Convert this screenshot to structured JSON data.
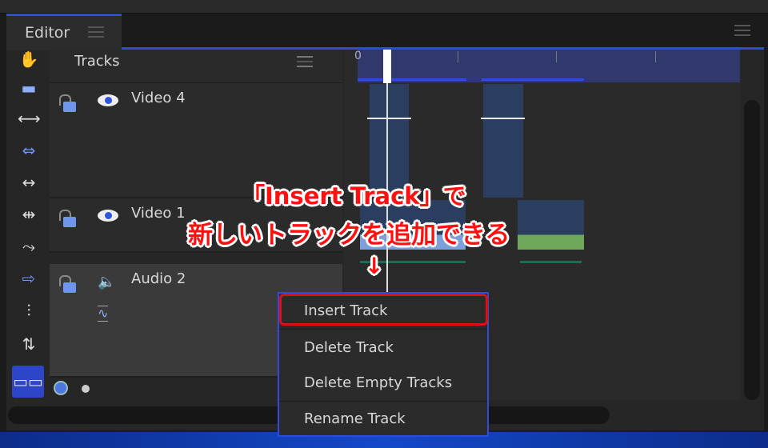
{
  "tab": {
    "title": "Editor"
  },
  "tracks": {
    "header": "Tracks",
    "rows": [
      {
        "name": "Video 4"
      },
      {
        "name": "Video 1"
      },
      {
        "name": "Audio 2"
      }
    ]
  },
  "ruler": {
    "start_label": "0"
  },
  "context_menu": {
    "items": [
      "Insert Track",
      "Delete Track",
      "Delete Empty Tracks",
      "Rename Track"
    ],
    "highlighted": "Insert Track"
  },
  "annotation": {
    "line1": "「Insert Track」で",
    "line2": "新しいトラックを追加できる",
    "arrow": "↓"
  },
  "colors": {
    "accent": "#2d4be0",
    "highlight": "#e01010",
    "annotation": "#ff1010"
  },
  "toolbar_icons": [
    "hand-icon",
    "ripple-icon",
    "fit-width-icon",
    "split-icon",
    "stretch-icon",
    "slide-icon",
    "curve-icon",
    "insert-icon",
    "mixer-icon",
    "sliders-icon",
    "group-icon"
  ]
}
